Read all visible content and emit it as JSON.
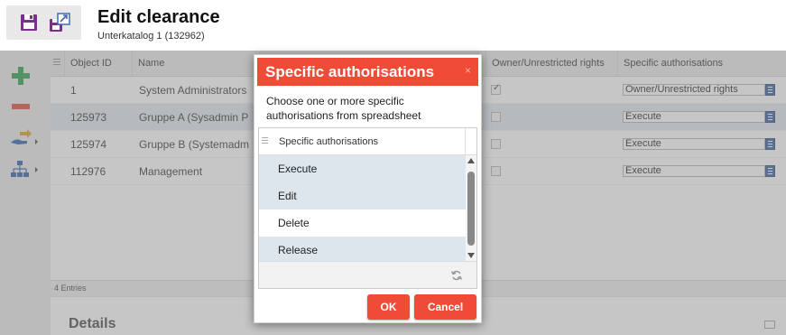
{
  "header": {
    "title": "Edit clearance",
    "subtitle": "Unterkatalog 1 (132962)"
  },
  "table": {
    "columns": [
      "Object ID",
      "Name",
      "Owner/Unrestricted rights",
      "Specific authorisations"
    ],
    "rows": [
      {
        "id": "1",
        "name": "System Administrators",
        "owner": true,
        "auth": "Owner/Unrestricted rights"
      },
      {
        "id": "125973",
        "name": "Gruppe A (Sysadmin P",
        "owner": false,
        "auth": "Execute"
      },
      {
        "id": "125974",
        "name": "Gruppe B (Systemadm",
        "owner": false,
        "auth": "Execute"
      },
      {
        "id": "112976",
        "name": "Management",
        "owner": false,
        "auth": "Execute"
      }
    ],
    "entries_count": "4 Entries"
  },
  "details": {
    "title": "Details"
  },
  "dialog": {
    "title": "Specific authorisations",
    "close": "×",
    "instruction": "Choose one or more specific authorisations from spreadsheet",
    "list_header": "Specific authorisations",
    "items": [
      {
        "label": "Execute",
        "selected": true
      },
      {
        "label": "Edit",
        "selected": true
      },
      {
        "label": "Delete",
        "selected": false
      },
      {
        "label": "Release",
        "selected": true
      }
    ],
    "ok_label": "OK",
    "cancel_label": "Cancel"
  },
  "icons": {
    "save": "save-icon",
    "save_as": "save-as-icon",
    "add": "plus-icon",
    "remove": "minus-icon",
    "transfer": "hand-transfer-icon",
    "hierarchy": "hierarchy-icon",
    "refresh": "refresh-icon"
  },
  "colors": {
    "accent": "#f04b36",
    "selected_row": "#e3ebf0",
    "icon_purple": "#7a2f8f",
    "icon_blue": "#3d6db5",
    "add_green": "#3aa655",
    "remove_red": "#e05a4a"
  }
}
